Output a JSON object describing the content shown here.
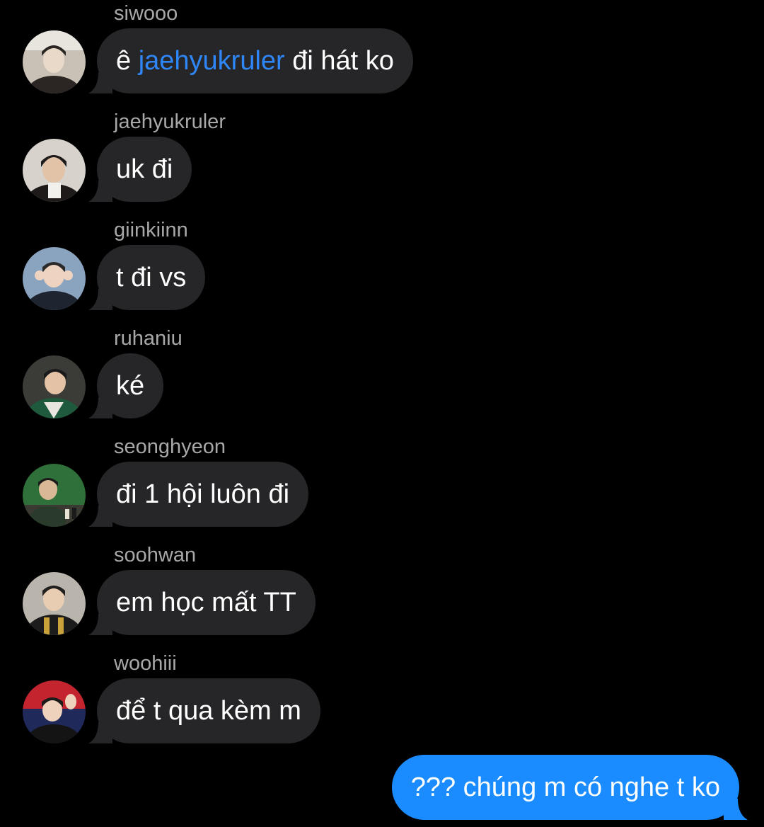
{
  "messages": [
    {
      "sender": "siwooo",
      "text_before": "ê ",
      "mention": "jaehyukruler",
      "text_after": " đi hát ko",
      "avatar_icon": "user-avatar-siwooo",
      "avatar_colors": [
        "#c9c1b6",
        "#2b2623",
        "#e8d9c9"
      ]
    },
    {
      "sender": "jaehyukruler",
      "text": "uk đi",
      "avatar_icon": "user-avatar-jaehyukruler",
      "avatar_colors": [
        "#d7d2cb",
        "#1d1a19",
        "#e3c3a7"
      ]
    },
    {
      "sender": "giinkiinn",
      "text": "t đi vs",
      "avatar_icon": "user-avatar-giinkiinn",
      "avatar_colors": [
        "#8aa3bf",
        "#1f2530",
        "#edd3c0"
      ]
    },
    {
      "sender": "ruhaniu",
      "text": "ké",
      "avatar_icon": "user-avatar-ruhaniu",
      "avatar_colors": [
        "#3b3b38",
        "#1e5a3b",
        "#e4c2a5"
      ]
    },
    {
      "sender": "seonghyeon",
      "text": "đi 1 hội luôn đi",
      "avatar_icon": "user-avatar-seonghyeon",
      "avatar_colors": [
        "#2f6f3a",
        "#3a3a32",
        "#d9b896"
      ]
    },
    {
      "sender": "soohwan",
      "text": "em học mất TT",
      "avatar_icon": "user-avatar-soohwan",
      "avatar_colors": [
        "#b9b4ac",
        "#1c1c1c",
        "#e9cdb3"
      ]
    },
    {
      "sender": "woohiii",
      "text": "để t qua kèm m",
      "avatar_icon": "user-avatar-woohiii",
      "avatar_colors": [
        "#c4242e",
        "#202a5a",
        "#efd2bc"
      ]
    }
  ],
  "outgoing": {
    "text": "??? chúng m có nghe t ko"
  },
  "colors": {
    "background": "#000000",
    "incoming_bubble": "#262628",
    "outgoing_bubble": "#1a8cff",
    "mention": "#2f86f6",
    "sender_name": "#a8a8a8"
  }
}
